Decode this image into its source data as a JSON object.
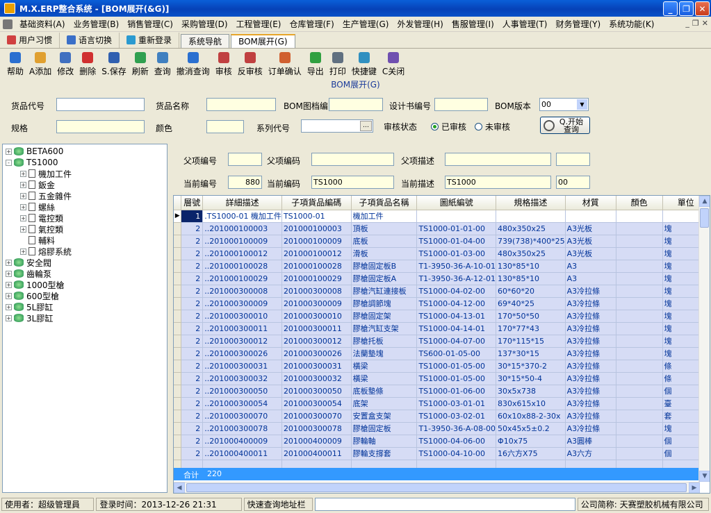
{
  "window": {
    "title": "M.X.ERP整合系统 - [BOM展开(&G)]"
  },
  "menu": [
    "基础资料(A)",
    "业务管理(B)",
    "销售管理(C)",
    "采购管理(D)",
    "工程管理(E)",
    "仓库管理(F)",
    "生产管理(G)",
    "外发管理(H)",
    "售服管理(I)",
    "人事管理(T)",
    "财务管理(Y)",
    "系统功能(K)"
  ],
  "quickbar": {
    "habit": "用户习惯",
    "lang": "语言切换",
    "relogin": "重新登录"
  },
  "tabs": [
    "系统导航",
    "BOM展开(G)"
  ],
  "toolbar": [
    "帮助",
    "A添加",
    "修改",
    "删除",
    "S.保存",
    "刷新",
    "查询",
    "撤消查询",
    "审核",
    "反审核",
    "订单确认",
    "导出",
    "打印",
    "快捷键",
    "C关闭"
  ],
  "form": {
    "title": "BOM展开(G)",
    "goods_code": "货品代号",
    "goods_name": "货品名称",
    "bom_doc": "BOM图档编",
    "design_no": "设计书编号",
    "bom_ver": "BOM版本",
    "bom_ver_value": "00",
    "spec": "规格",
    "color": "颜色",
    "series": "系列代号",
    "audit_status": "审核状态",
    "audited": "已审核",
    "unaudited": "未审核",
    "query_btn": "Q.开始查询"
  },
  "header": {
    "parent_no": "父项编号",
    "parent_code": "父项编码",
    "parent_desc": "父项描述",
    "cur_no": "当前编号",
    "cur_no_value": "880",
    "cur_code": "当前编码",
    "cur_code_value": "TS1000",
    "cur_desc": "当前描述",
    "cur_desc_value": "TS1000",
    "cur_ver_value": "00"
  },
  "tree": [
    {
      "label": "BETA600",
      "level": 0,
      "type": "db",
      "exp": "+"
    },
    {
      "label": "TS1000",
      "level": 0,
      "type": "db",
      "exp": "-"
    },
    {
      "label": "機加工件",
      "level": 1,
      "type": "doc",
      "exp": "+"
    },
    {
      "label": "鈑金",
      "level": 1,
      "type": "doc",
      "exp": "+"
    },
    {
      "label": "五金雜件",
      "level": 1,
      "type": "doc",
      "exp": "+"
    },
    {
      "label": "螺絲",
      "level": 1,
      "type": "doc",
      "exp": "+"
    },
    {
      "label": "電控類",
      "level": 1,
      "type": "doc",
      "exp": "+"
    },
    {
      "label": "氣控類",
      "level": 1,
      "type": "doc",
      "exp": "+"
    },
    {
      "label": "輔料",
      "level": 1,
      "type": "doc",
      "exp": ""
    },
    {
      "label": "熔膠系統",
      "level": 1,
      "type": "doc",
      "exp": "+"
    },
    {
      "label": "安全閥",
      "level": 0,
      "type": "db",
      "exp": "+"
    },
    {
      "label": "齒輪泵",
      "level": 0,
      "type": "db",
      "exp": "+"
    },
    {
      "label": "1000型槍",
      "level": 0,
      "type": "db",
      "exp": "+"
    },
    {
      "label": "600型槍",
      "level": 0,
      "type": "db",
      "exp": "+"
    },
    {
      "label": "5L膠缸",
      "level": 0,
      "type": "db",
      "exp": "+"
    },
    {
      "label": "3L膠缸",
      "level": 0,
      "type": "db",
      "exp": "+"
    }
  ],
  "grid": {
    "columns": [
      "層號",
      "詳細描述",
      "子項貨品編碼",
      "子項貨品名稱",
      "圖紙編號",
      "規格描述",
      "材質",
      "顏色",
      "單位"
    ],
    "rows": [
      [
        "1",
        ".TS1000-01 機加工件",
        "TS1000-01",
        "機加工件",
        "",
        "",
        "",
        "",
        ""
      ],
      [
        "2",
        "..201000100003",
        "201000100003",
        "頂板",
        "TS1000-01-01-00",
        "480x350x25",
        "A3光板",
        "",
        "塊"
      ],
      [
        "2",
        "..201000100009",
        "201000100009",
        "底板",
        "TS1000-01-04-00",
        "739(738)*400*25",
        "A3光板",
        "",
        "塊"
      ],
      [
        "2",
        "..201000100012",
        "201000100012",
        "滑板",
        "TS1000-01-03-00",
        "480x350x25",
        "A3光板",
        "",
        "塊"
      ],
      [
        "2",
        "..201000100028",
        "201000100028",
        "膠槍固定板B",
        "T1-3950-36-A-10-01",
        "130*85*10",
        "A3",
        "",
        "塊"
      ],
      [
        "2",
        "..201000100029",
        "201000100029",
        "膠槍固定板A",
        "T1-3950-36-A-12-01",
        "130*85*10",
        "A3",
        "",
        "塊"
      ],
      [
        "2",
        "..201000300008",
        "201000300008",
        "膠槍汽缸連接板",
        "TS1000-04-02-00",
        "60*60*20",
        "A3冷拉條",
        "",
        "塊"
      ],
      [
        "2",
        "..201000300009",
        "201000300009",
        "膠槍調節塊",
        "TS1000-04-12-00",
        "69*40*25",
        "A3冷拉條",
        "",
        "塊"
      ],
      [
        "2",
        "..201000300010",
        "201000300010",
        "膠槍固定架",
        "TS1000-04-13-01",
        "170*50*50",
        "A3冷拉條",
        "",
        "塊"
      ],
      [
        "2",
        "..201000300011",
        "201000300011",
        "膠槍汽缸支架",
        "TS1000-04-14-01",
        "170*77*43",
        "A3冷拉條",
        "",
        "塊"
      ],
      [
        "2",
        "..201000300012",
        "201000300012",
        "膠槍托板",
        "TS1000-04-07-00",
        "170*115*15",
        "A3冷拉條",
        "",
        "塊"
      ],
      [
        "2",
        "..201000300026",
        "201000300026",
        "法蘭墊塊",
        "TS600-01-05-00",
        "137*30*15",
        "A3冷拉條",
        "",
        "塊"
      ],
      [
        "2",
        "..201000300031",
        "201000300031",
        "橫梁",
        "TS1000-01-05-00",
        "30*15*370-2",
        "A3冷拉條",
        "",
        "條"
      ],
      [
        "2",
        "..201000300032",
        "201000300032",
        "橫梁",
        "TS1000-01-05-00",
        "30*15*50-4",
        "A3冷拉條",
        "",
        "條"
      ],
      [
        "2",
        "..201000300050",
        "201000300050",
        "底板墊條",
        "TS1000-01-06-00",
        "30x5x738",
        "A3冷拉條",
        "",
        "個"
      ],
      [
        "2",
        "..201000300054",
        "201000300054",
        "底架",
        "TS1000-03-01-01",
        "830x615x10",
        "A3冷拉條",
        "",
        "臺"
      ],
      [
        "2",
        "..201000300070",
        "201000300070",
        "安置盒支架",
        "TS1000-03-02-01",
        "60x10x88-2-30x",
        "A3冷拉條",
        "",
        "套"
      ],
      [
        "2",
        "..201000300078",
        "201000300078",
        "膠槍固定板",
        "T1-3950-36-A-08-00",
        "50x45x5±0.2",
        "A3冷拉條",
        "",
        "塊"
      ],
      [
        "2",
        "..201000400009",
        "201000400009",
        "膠輪軸",
        "TS1000-04-06-00",
        "Φ10x75",
        "A3圓棒",
        "",
        "個"
      ],
      [
        "2",
        "..201000400011",
        "201000400011",
        "膠輪支撐套",
        "TS1000-04-10-00",
        "16六方X75",
        "A3六方",
        "",
        "個"
      ]
    ],
    "sum_label": "合计",
    "sum_value": "220"
  },
  "status": {
    "user": "使用者：超级管理員",
    "login": "登录时间：2013-12-26 21:31",
    "quick": "快速查询地址栏",
    "company": "公司简称: 天赛塑胶机械有限公司"
  }
}
